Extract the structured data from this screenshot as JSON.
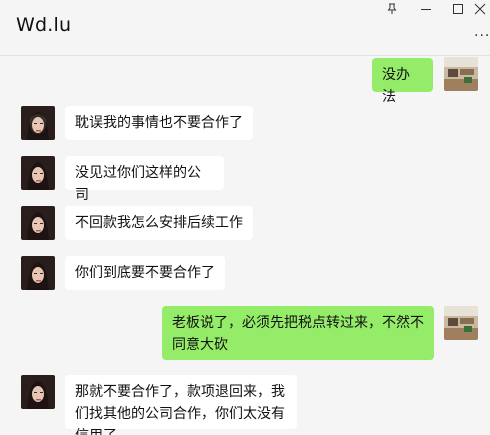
{
  "header": {
    "title": "Wd.lu",
    "more_icon": "more-icon"
  },
  "window_controls": {
    "pin_icon": "pin-icon",
    "minimize_icon": "minimize-icon",
    "maximize_icon": "maximize-icon",
    "close_icon": "close-icon"
  },
  "colors": {
    "outgoing_bubble": "#95ec69",
    "incoming_bubble": "#ffffff",
    "background": "#f5f5f5"
  },
  "messages": [
    {
      "side": "out",
      "text": "没办法"
    },
    {
      "side": "in",
      "text": "耽误我的事情也不要合作了"
    },
    {
      "side": "in",
      "text": "没见过你们这样的公司"
    },
    {
      "side": "in",
      "text": "不回款我怎么安排后续工作"
    },
    {
      "side": "in",
      "text": "你们到底要不要合作了"
    },
    {
      "side": "out",
      "text": "老板说了，必须先把税点转过来，不然不同意大砍"
    },
    {
      "side": "in",
      "text": "那就不要合作了，款项退回来，我们找其他的公司合作，你们太没有信用了"
    }
  ]
}
